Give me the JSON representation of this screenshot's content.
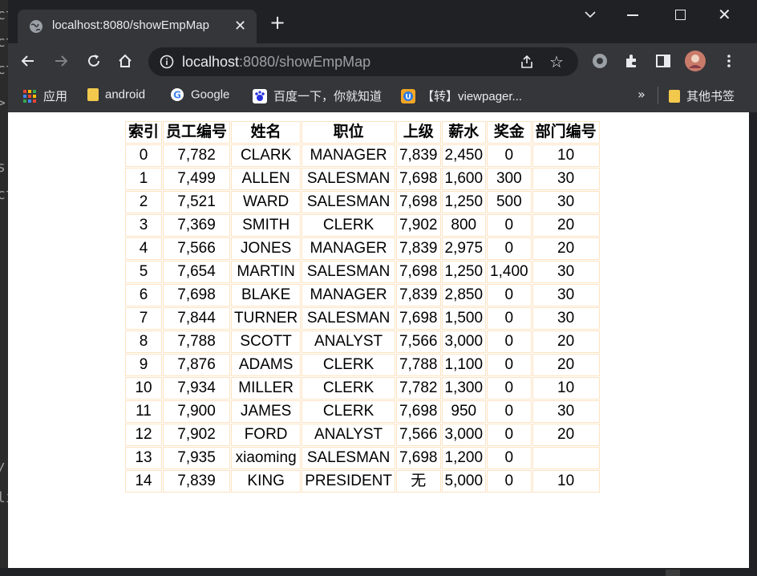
{
  "editor_strip": [
    "ct",
    "ct",
    "ct",
    ">",
    "s",
    "ct",
    "/",
    "li"
  ],
  "browser": {
    "tab_title": "localhost:8080/showEmpMap",
    "url_host": "localhost",
    "url_path": ":8080/showEmpMap",
    "bookmarks": [
      {
        "label": "应用",
        "icon": "apps-grid-icon"
      },
      {
        "label": "android",
        "icon": "folder-icon"
      },
      {
        "label": "Google",
        "icon": "google-icon"
      },
      {
        "label": "百度一下，你就知道",
        "icon": "baidu-icon"
      },
      {
        "label": "【转】viewpager...",
        "icon": "uc-icon"
      }
    ],
    "other_bookmarks": "其他书签",
    "more": "»",
    "accent": "#35363a"
  },
  "table": {
    "headers": [
      "索引",
      "员工编号",
      "姓名",
      "职位",
      "上级",
      "薪水",
      "奖金",
      "部门编号"
    ],
    "rows": [
      [
        "0",
        "7,782",
        "CLARK",
        "MANAGER",
        "7,839",
        "2,450",
        "0",
        "10"
      ],
      [
        "1",
        "7,499",
        "ALLEN",
        "SALESMAN",
        "7,698",
        "1,600",
        "300",
        "30"
      ],
      [
        "2",
        "7,521",
        "WARD",
        "SALESMAN",
        "7,698",
        "1,250",
        "500",
        "30"
      ],
      [
        "3",
        "7,369",
        "SMITH",
        "CLERK",
        "7,902",
        "800",
        "0",
        "20"
      ],
      [
        "4",
        "7,566",
        "JONES",
        "MANAGER",
        "7,839",
        "2,975",
        "0",
        "20"
      ],
      [
        "5",
        "7,654",
        "MARTIN",
        "SALESMAN",
        "7,698",
        "1,250",
        "1,400",
        "30"
      ],
      [
        "6",
        "7,698",
        "BLAKE",
        "MANAGER",
        "7,839",
        "2,850",
        "0",
        "30"
      ],
      [
        "7",
        "7,844",
        "TURNER",
        "SALESMAN",
        "7,698",
        "1,500",
        "0",
        "30"
      ],
      [
        "8",
        "7,788",
        "SCOTT",
        "ANALYST",
        "7,566",
        "3,000",
        "0",
        "20"
      ],
      [
        "9",
        "7,876",
        "ADAMS",
        "CLERK",
        "7,788",
        "1,100",
        "0",
        "20"
      ],
      [
        "10",
        "7,934",
        "MILLER",
        "CLERK",
        "7,782",
        "1,300",
        "0",
        "10"
      ],
      [
        "11",
        "7,900",
        "JAMES",
        "CLERK",
        "7,698",
        "950",
        "0",
        "30"
      ],
      [
        "12",
        "7,902",
        "FORD",
        "ANALYST",
        "7,566",
        "3,000",
        "0",
        "20"
      ],
      [
        "13",
        "7,935",
        "xiaoming",
        "SALESMAN",
        "7,698",
        "1,200",
        "0",
        ""
      ],
      [
        "14",
        "7,839",
        "KING",
        "PRESIDENT",
        "无",
        "5,000",
        "0",
        "10"
      ]
    ],
    "border_color": "#fde3c2"
  }
}
